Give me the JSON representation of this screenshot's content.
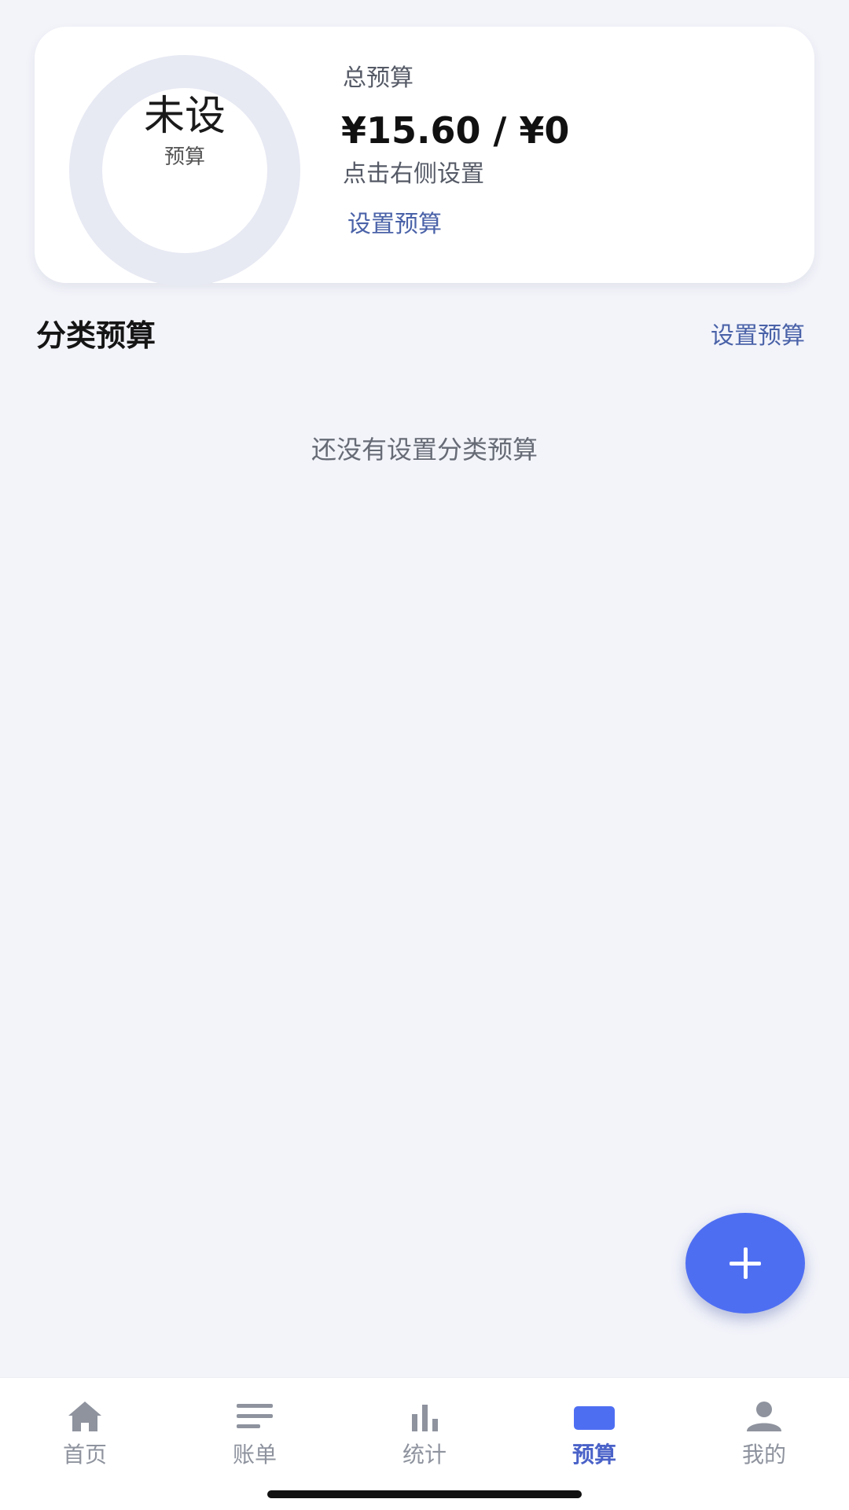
{
  "budget_card": {
    "ring_main": "未设",
    "ring_sub": "预算",
    "total_label": "总预算",
    "total_amount": "¥15.60 / ¥0",
    "hint": "点击右侧设置",
    "set_link": "设置预算"
  },
  "category_section": {
    "title": "分类预算",
    "set_link": "设置预算",
    "empty_text": "还没有设置分类预算"
  },
  "fab": {
    "icon": "plus-icon",
    "color": "#4e6ef2"
  },
  "tabbar": {
    "active_color": "#4a62c8",
    "inactive_color": "#8e939e",
    "items": [
      {
        "label": "首页",
        "icon": "home-icon",
        "active": false
      },
      {
        "label": "账单",
        "icon": "list-icon",
        "active": false
      },
      {
        "label": "统计",
        "icon": "bar-chart-icon",
        "active": false
      },
      {
        "label": "预算",
        "icon": "wallet-icon",
        "active": true
      },
      {
        "label": "我的",
        "icon": "user-icon",
        "active": false
      }
    ]
  }
}
